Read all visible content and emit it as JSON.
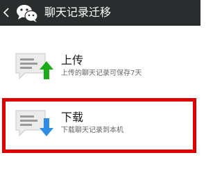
{
  "header": {
    "back_icon": "chevron-left-icon",
    "app_icon": "wechat-icon",
    "title": "聊天记录迁移"
  },
  "options": [
    {
      "label": "上传",
      "description": "上传的聊天记录可保存7天",
      "icon": "chat-upload-icon",
      "accent_color": "#1aad19"
    },
    {
      "label": "下载",
      "description": "下载聊天记录到本机",
      "icon": "chat-download-icon",
      "accent_color": "#2d8de6"
    }
  ],
  "highlight_color": "#e00000"
}
